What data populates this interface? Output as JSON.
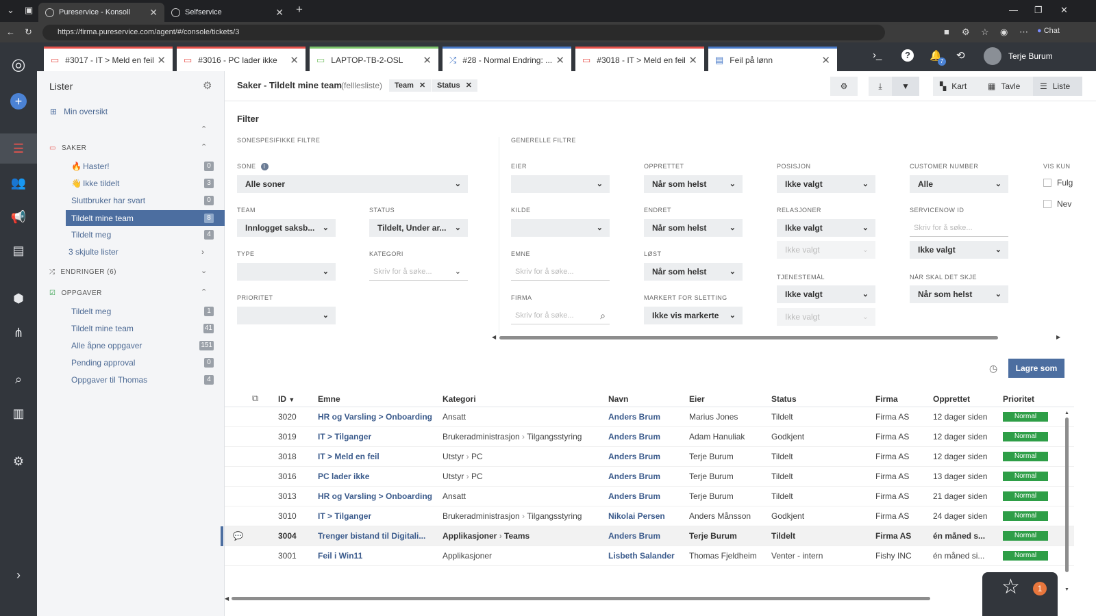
{
  "browser": {
    "tabs": [
      {
        "label": "Pureservice - Konsoll"
      },
      {
        "label": "Selfservice"
      }
    ],
    "url": "https://firma.pureservice.com/agent/#/console/tickets/3",
    "chat_label": "Chat"
  },
  "app_tabs": [
    {
      "label": "#3017 - IT > Meld en feil"
    },
    {
      "label": "#3016 - PC lader ikke"
    },
    {
      "label": "LAPTOP-TB-2-OSL"
    },
    {
      "label": "#28 - Normal Endring: ..."
    },
    {
      "label": "#3018 - IT > Meld en feil"
    },
    {
      "label": "Feil på lønn"
    }
  ],
  "user": {
    "name": "Terje Burum",
    "notifications": "7"
  },
  "sidebar": {
    "title": "Lister",
    "overview": "Min oversikt",
    "saker": {
      "title": "SAKER",
      "items": [
        {
          "label": "Haster!",
          "count": "0"
        },
        {
          "label": "Ikke tildelt",
          "count": "3"
        },
        {
          "label": "Sluttbruker har svart",
          "count": "0"
        },
        {
          "label": "Tildelt mine team",
          "count": "8"
        },
        {
          "label": "Tildelt meg",
          "count": "4"
        },
        {
          "label": "3 skjulte lister"
        }
      ]
    },
    "endringer": {
      "title": "ENDRINGER (6)"
    },
    "oppgaver": {
      "title": "OPPGAVER",
      "items": [
        {
          "label": "Tildelt meg",
          "count": "1"
        },
        {
          "label": "Tildelt mine team",
          "count": "41"
        },
        {
          "label": "Alle åpne oppgaver",
          "count": "151"
        },
        {
          "label": "Pending approval",
          "count": "0"
        },
        {
          "label": "Oppgaver til Thomas",
          "count": "4"
        }
      ]
    }
  },
  "header": {
    "title": "Saker - Tildelt mine team",
    "subtitle": "(felllesliste)",
    "pills": [
      "Team",
      "Status"
    ],
    "views": [
      "Kart",
      "Tavle",
      "Liste"
    ]
  },
  "filter": {
    "title": "Filter",
    "sone_section": "SONESPESIFIKKE FILTRE",
    "general_section": "GENERELLE FILTRE",
    "sone": {
      "label": "SONE",
      "value": "Alle soner"
    },
    "team": {
      "label": "TEAM",
      "value": "Innlogget saksb..."
    },
    "status": {
      "label": "STATUS",
      "value": "Tildelt, Under ar..."
    },
    "type": {
      "label": "TYPE"
    },
    "kategori": {
      "label": "KATEGORI",
      "placeholder": "Skriv for å søke..."
    },
    "prioritet": {
      "label": "PRIORITET"
    },
    "eier": {
      "label": "EIER"
    },
    "kilde": {
      "label": "KILDE"
    },
    "emne": {
      "label": "EMNE",
      "placeholder": "Skriv for å søke..."
    },
    "firma": {
      "label": "FIRMA",
      "placeholder": "Skriv for å søke..."
    },
    "opprettet": {
      "label": "OPPRETTET",
      "value": "Når som helst"
    },
    "endret": {
      "label": "ENDRET",
      "value": "Når som helst"
    },
    "lost": {
      "label": "LØST",
      "value": "Når som helst"
    },
    "markert": {
      "label": "MARKERT FOR SLETTING",
      "value": "Ikke vis markerte"
    },
    "posisjon": {
      "label": "POSISJON",
      "value": "Ikke valgt"
    },
    "relasjoner": {
      "label": "RELASJONER",
      "value": "Ikke valgt",
      "value2": "Ikke valgt"
    },
    "tjenestemal": {
      "label": "TJENESTEMÅL",
      "value": "Ikke valgt",
      "value2": "Ikke valgt"
    },
    "customer_number": {
      "label": "CUSTOMER NUMBER",
      "value": "Alle"
    },
    "servicenow": {
      "label": "SERVICENOW ID",
      "placeholder": "Skriv for å søke...",
      "value": "Ikke valgt"
    },
    "nar_skal": {
      "label": "NÅR SKAL DET SKJE",
      "value": "Når som helst"
    },
    "vis_kun": {
      "label": "VIS KUN",
      "opt1": "Fulg",
      "opt2": "Nev"
    },
    "save_label": "Lagre som"
  },
  "table": {
    "columns": [
      "ID",
      "Emne",
      "Kategori",
      "Navn",
      "Eier",
      "Status",
      "Firma",
      "Opprettet",
      "Prioritet"
    ],
    "rows": [
      {
        "id": "3020",
        "emne": "HR og Varsling > Onboarding",
        "kat1": "Ansatt",
        "kat2": "",
        "navn": "Anders Brum",
        "eier": "Marius Jones",
        "status": "Tildelt",
        "firma": "Firma AS",
        "opprettet": "12 dager siden",
        "prioritet": "Normal"
      },
      {
        "id": "3019",
        "emne": "IT > Tilganger",
        "kat1": "Brukeradministrasjon",
        "kat2": "Tilgangsstyring",
        "navn": "Anders Brum",
        "eier": "Adam Hanuliak",
        "status": "Godkjent",
        "firma": "Firma AS",
        "opprettet": "12 dager siden",
        "prioritet": "Normal"
      },
      {
        "id": "3018",
        "emne": "IT > Meld en feil",
        "kat1": "Utstyr",
        "kat2": "PC",
        "navn": "Anders Brum",
        "eier": "Terje Burum",
        "status": "Tildelt",
        "firma": "Firma AS",
        "opprettet": "12 dager siden",
        "prioritet": "Normal"
      },
      {
        "id": "3016",
        "emne": "PC lader ikke",
        "kat1": "Utstyr",
        "kat2": "PC",
        "navn": "Anders Brum",
        "eier": "Terje Burum",
        "status": "Tildelt",
        "firma": "Firma AS",
        "opprettet": "13 dager siden",
        "prioritet": "Normal"
      },
      {
        "id": "3013",
        "emne": "HR og Varsling > Onboarding",
        "kat1": "Ansatt",
        "kat2": "",
        "navn": "Anders Brum",
        "eier": "Terje Burum",
        "status": "Tildelt",
        "firma": "Firma AS",
        "opprettet": "21 dager siden",
        "prioritet": "Normal"
      },
      {
        "id": "3010",
        "emne": "IT > Tilganger",
        "kat1": "Brukeradministrasjon",
        "kat2": "Tilgangsstyring",
        "navn": "Nikolai Persen",
        "eier": "Anders Månsson",
        "status": "Godkjent",
        "firma": "Firma AS",
        "opprettet": "24 dager siden",
        "prioritet": "Normal"
      },
      {
        "id": "3004",
        "emne": "Trenger bistand til Digitali...",
        "kat1": "Applikasjoner",
        "kat2": "Teams",
        "navn": "Anders Brum",
        "eier": "Terje Burum",
        "status": "Tildelt",
        "firma": "Firma AS",
        "opprettet": "én måned s...",
        "prioritet": "Normal"
      },
      {
        "id": "3001",
        "emne": "Feil i Win11",
        "kat1": "Applikasjoner",
        "kat2": "",
        "navn": "Lisbeth Salander",
        "eier": "Thomas Fjeldheim",
        "status": "Venter - intern",
        "firma": "Fishy INC",
        "opprettet": "én måned si...",
        "prioritet": "Normal"
      }
    ]
  },
  "fab": {
    "count": "1"
  }
}
